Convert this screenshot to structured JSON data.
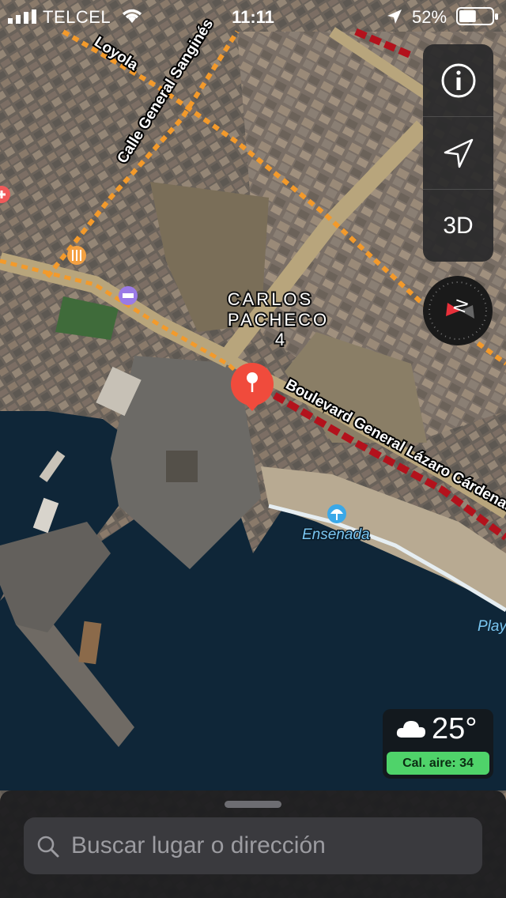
{
  "status_bar": {
    "carrier": "TELCEL",
    "time": "11:11",
    "battery_percent": "52%",
    "battery_level": 0.52,
    "icons": [
      "signal-icon",
      "wifi-icon",
      "location-arrow-icon",
      "battery-icon"
    ]
  },
  "map": {
    "streets": {
      "loyola": "Loyola",
      "sanginés": "Calle General Sanginés",
      "lazaro": "Boulevard General Lázaro Cárdenas"
    },
    "neighborhood": [
      "CARLOS",
      "PACHECO",
      "4"
    ],
    "places": {
      "ensenada": "Ensenada",
      "playa": "Play"
    },
    "pois": [
      "restaurant-icon",
      "hotel-icon",
      "hospital-icon",
      "beach-umbrella-icon",
      "pin-icon"
    ],
    "colors": {
      "water": "#0f2638",
      "road_traffic_moderate": "#f39a2b",
      "road_traffic_heavy": "#b3121c",
      "pin": "#f04b3c"
    }
  },
  "controls": {
    "info_icon": "info-icon",
    "location_icon": "location-arrow-icon",
    "three_d_label": "3D",
    "compass_icon": "compass-icon"
  },
  "weather": {
    "temperature": "25°",
    "icon": "cloud-icon",
    "air_quality": "Cal. aire: 34",
    "air_quality_color": "#4fd36a"
  },
  "search": {
    "placeholder": "Buscar lugar o dirección"
  }
}
